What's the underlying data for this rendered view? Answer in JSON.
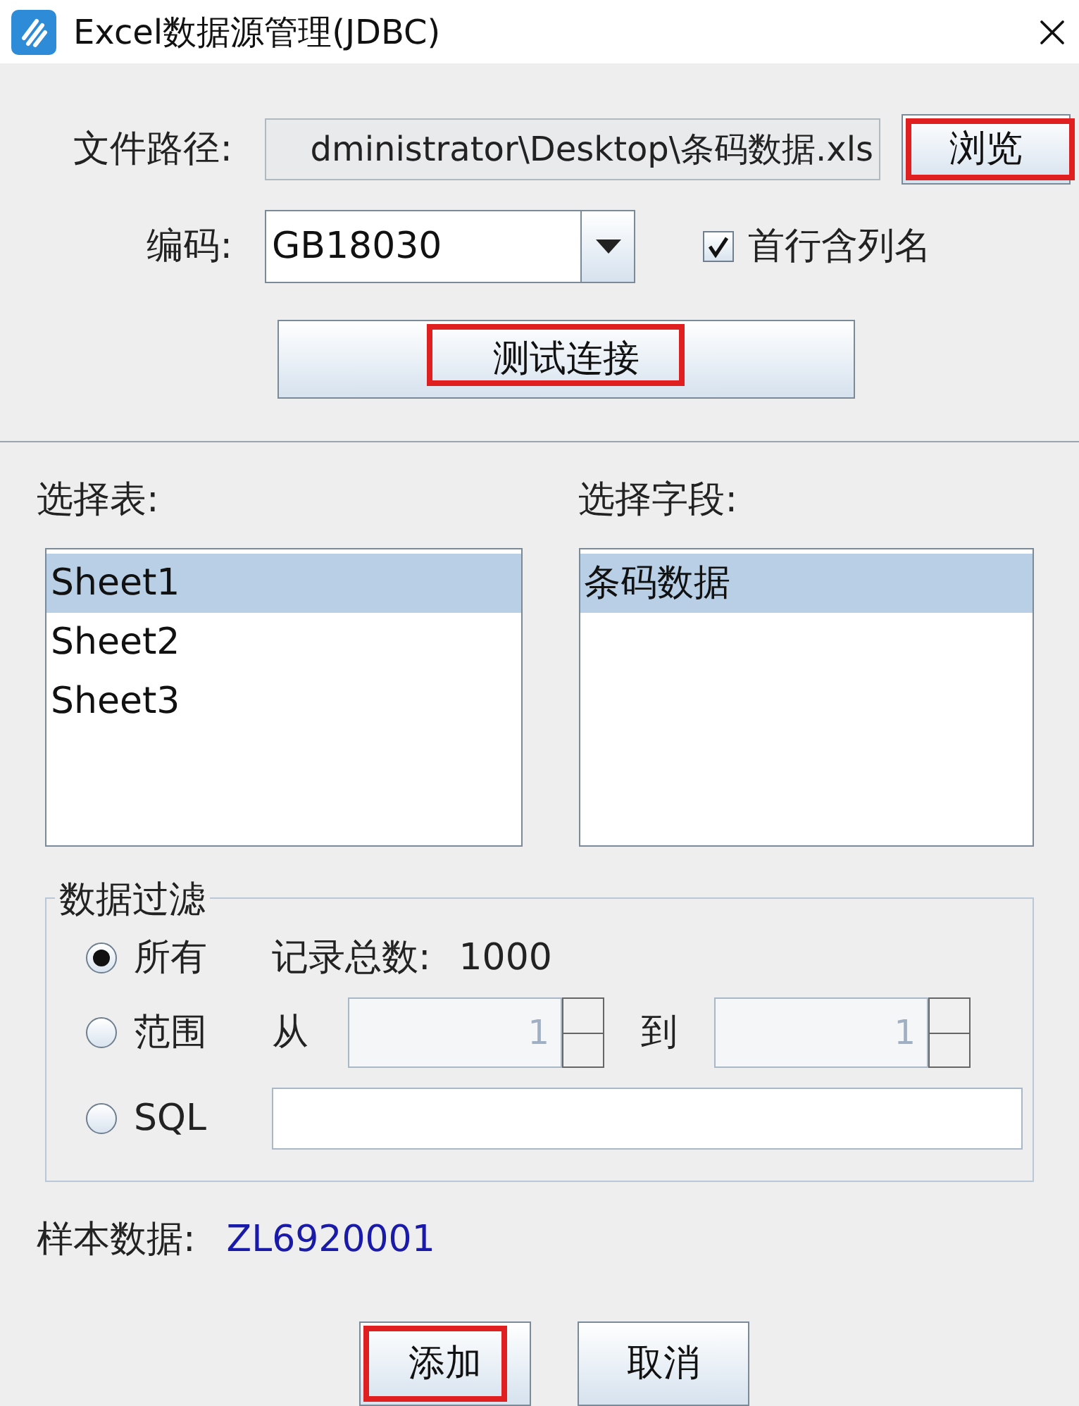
{
  "window": {
    "title": "Excel数据源管理(JDBC)"
  },
  "file_path": {
    "label": "文件路径:",
    "value": "dministrator\\Desktop\\条码数据.xls",
    "button": {
      "label": "浏览",
      "highlighted": true
    }
  },
  "encoding": {
    "label": "编码:",
    "value": "GB18030"
  },
  "header_row": {
    "label": "首行含列名",
    "checked": true
  },
  "test_button": {
    "label": "测试连接",
    "highlighted": true
  },
  "tables": {
    "label": "选择表:",
    "items": [
      {
        "label": "Sheet1",
        "selected": true
      },
      {
        "label": "Sheet2",
        "selected": false
      },
      {
        "label": "Sheet3",
        "selected": false
      }
    ]
  },
  "fields": {
    "label": "选择字段:",
    "items": [
      {
        "label": "条码数据",
        "selected": true
      }
    ]
  },
  "filter": {
    "title": "数据过滤",
    "options": [
      {
        "kind": "all",
        "label": "所有",
        "selected": true,
        "count_label": "记录总数:",
        "count": "1000"
      },
      {
        "kind": "range",
        "label": "范围",
        "selected": false,
        "from_label": "从",
        "from": "1",
        "to_label": "到",
        "to": "1"
      },
      {
        "kind": "sql",
        "label": "SQL",
        "selected": false
      }
    ]
  },
  "sample": {
    "label": "样本数据:",
    "value": "ZL6920001"
  },
  "buttons": [
    {
      "label": "添加",
      "highlighted": true
    },
    {
      "label": "取消",
      "highlighted": false
    }
  ]
}
